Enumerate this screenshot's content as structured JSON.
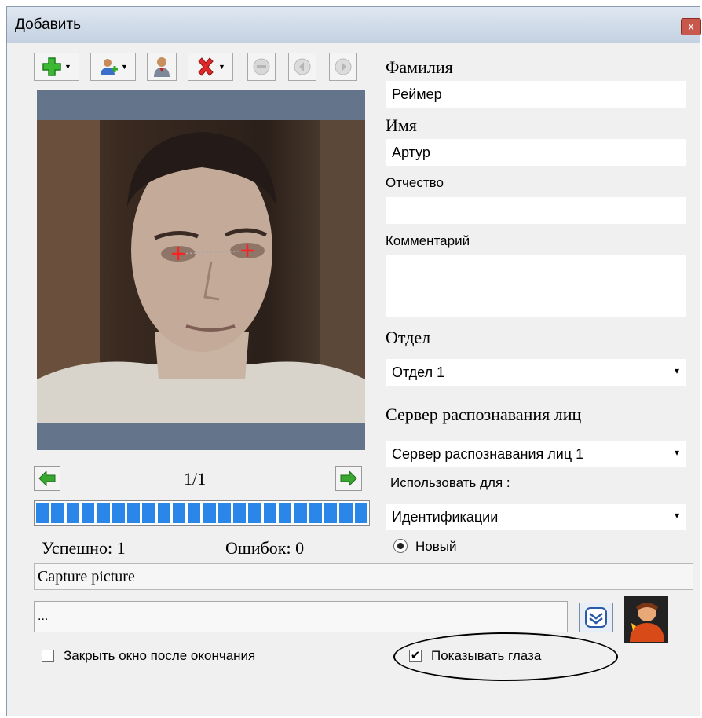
{
  "window": {
    "title": "Добавить",
    "close_glyph": "x"
  },
  "toolbar": {
    "buttons": [
      {
        "name": "add-button",
        "icon": "green-plus-icon",
        "dropdown": true
      },
      {
        "name": "add-person-button",
        "icon": "user-add-icon",
        "dropdown": true
      },
      {
        "name": "person-button",
        "icon": "user-icon",
        "dropdown": false
      },
      {
        "name": "delete-button",
        "icon": "red-x-icon",
        "dropdown": true
      },
      {
        "name": "stop-button",
        "icon": "stop-icon-disabled",
        "dropdown": false
      },
      {
        "name": "prev-button",
        "icon": "left-arrow-icon-disabled",
        "dropdown": false
      },
      {
        "name": "next-button",
        "icon": "right-arrow-icon-disabled",
        "dropdown": false
      }
    ]
  },
  "photo": {
    "counter": "1/1",
    "success_label": "Успешно: 1",
    "errors_label": "Ошибок: 0",
    "progress_segments": 22,
    "progress_fraction": 1.0
  },
  "form": {
    "last_name_label": "Фамилия",
    "last_name_value": "Реймер",
    "first_name_label": "Имя",
    "first_name_value": "Артур",
    "middle_name_label": "Отчество",
    "middle_name_value": "",
    "comment_label": "Комментарий",
    "comment_value": "",
    "department_label": "Отдел",
    "department_value": "Отдел 1",
    "server_label": "Сервер распознавания лиц",
    "server_value": "Сервер распознавания лиц 1",
    "use_for_label": "Использовать для :",
    "use_for_value": "Идентификации",
    "new_radio_label": "Новый",
    "dropdown_glyph": "▾"
  },
  "capture": {
    "label": "Capture picture",
    "path_value": "..."
  },
  "options": {
    "close_after_label": "Закрыть окно после окончания",
    "close_after_checked": false,
    "show_eyes_label": "Показывать глаза",
    "show_eyes_checked": true,
    "check_glyph": "✔"
  },
  "colors": {
    "accent_blue": "#2a86e8",
    "photo_frame": "#63748b",
    "green_arrow": "#3aa830"
  }
}
